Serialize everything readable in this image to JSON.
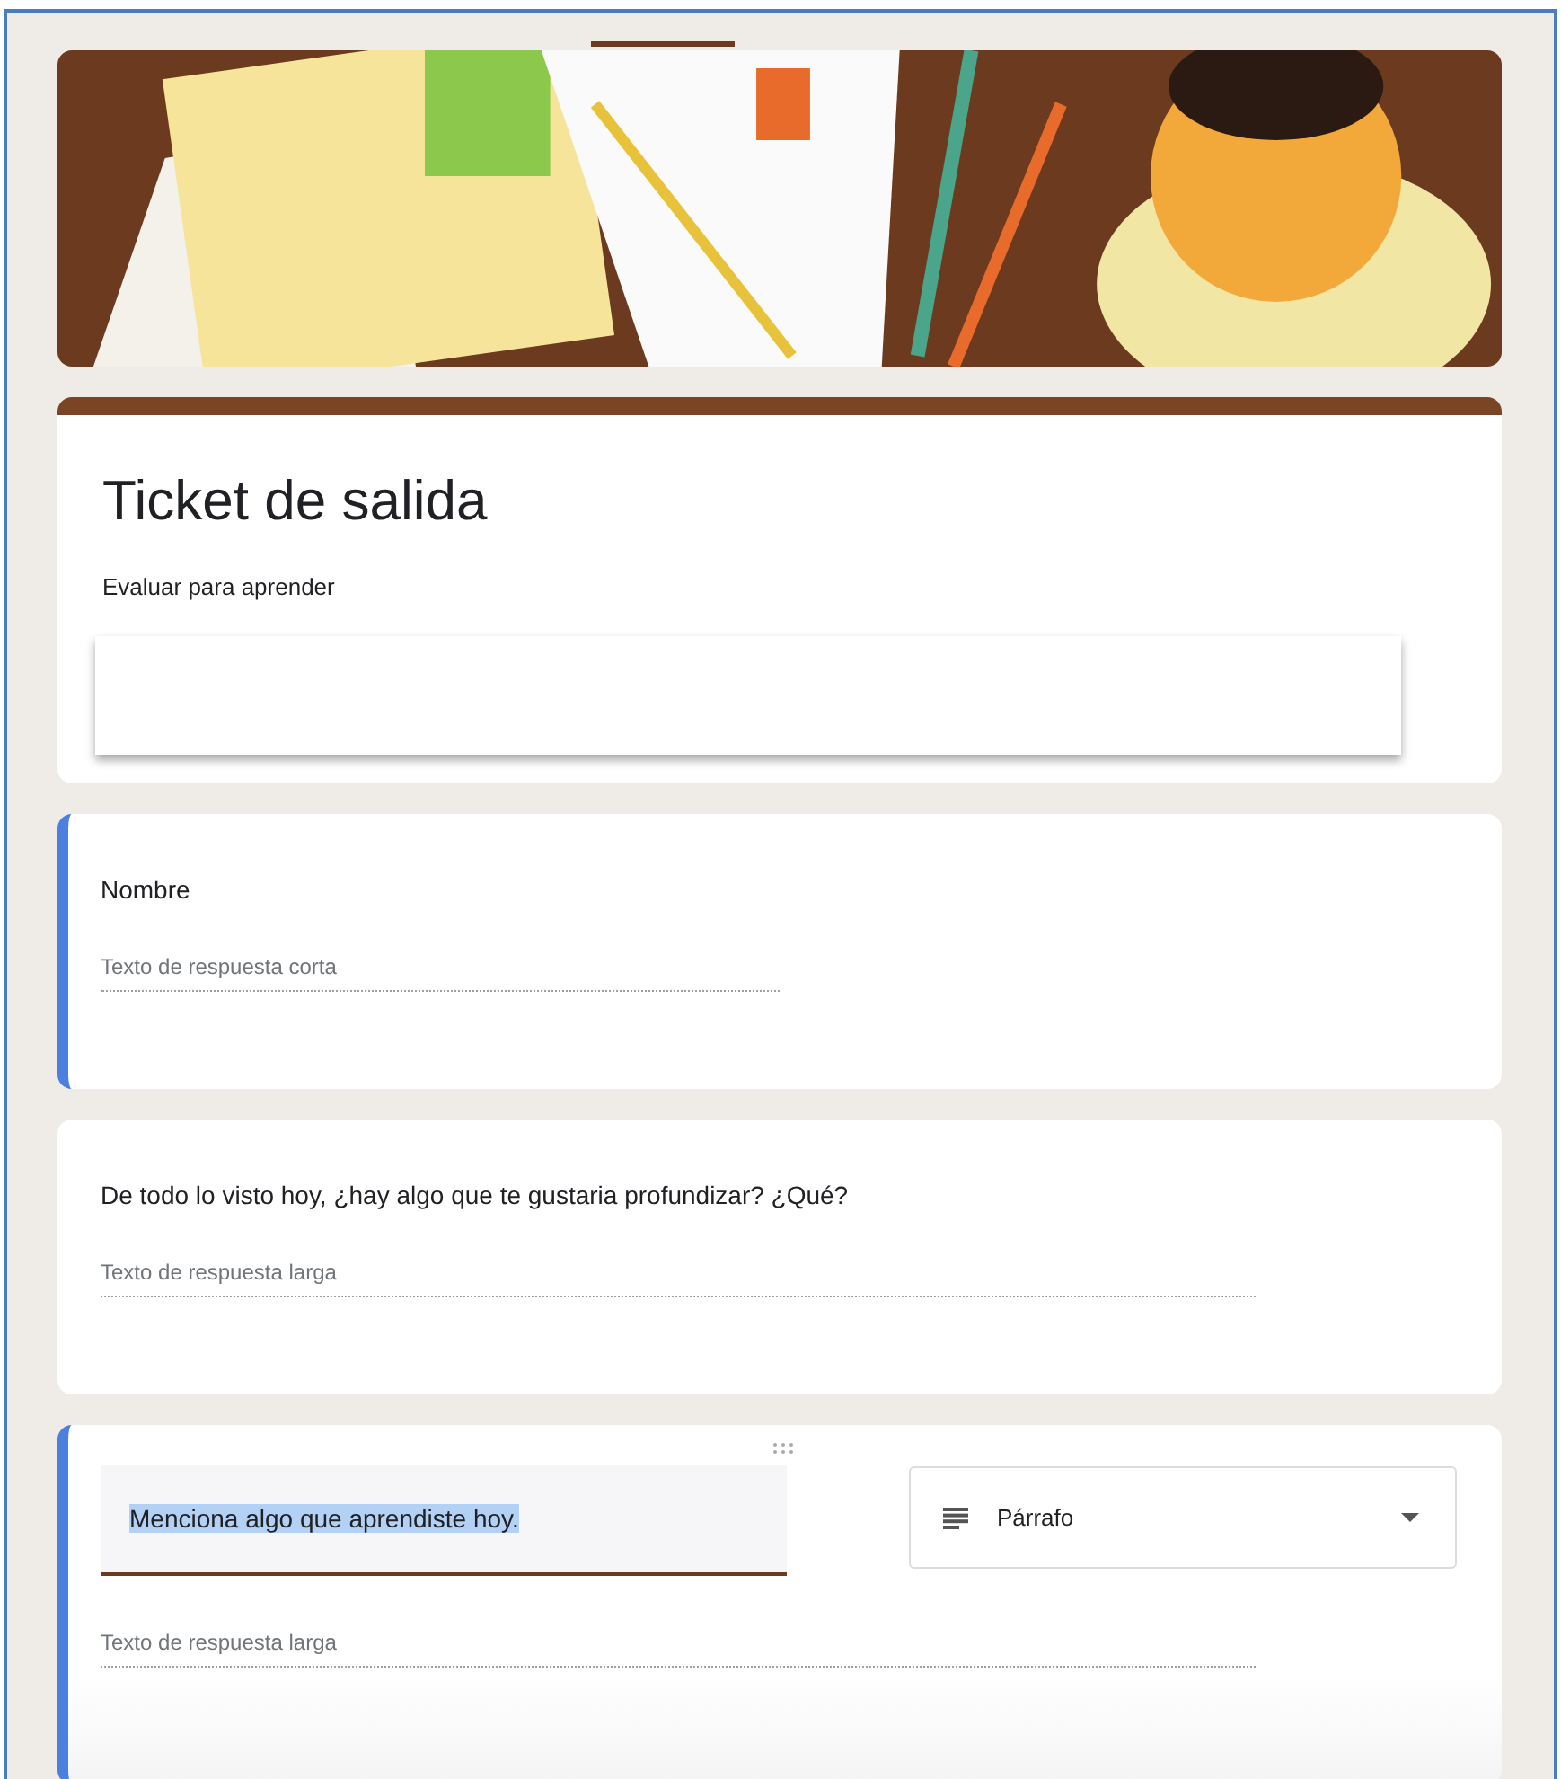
{
  "header": {
    "title": "Ticket de salida",
    "description": "Evaluar para aprender"
  },
  "questions": [
    {
      "kind": "view",
      "highlighted": true,
      "title": "Nombre",
      "long_answer": false,
      "placeholder": "Texto de respuesta corta"
    },
    {
      "kind": "view",
      "highlighted": false,
      "title": "De todo lo visto hoy, ¿hay algo que te gustaria profundizar? ¿Qué?",
      "long_answer": true,
      "placeholder": "Texto de respuesta larga"
    },
    {
      "kind": "edit",
      "highlighted": true,
      "title": "Menciona algo que aprendiste hoy.",
      "title_selected": true,
      "type_label": "Párrafo",
      "long_answer": true,
      "placeholder": "Texto de respuesta larga"
    }
  ]
}
